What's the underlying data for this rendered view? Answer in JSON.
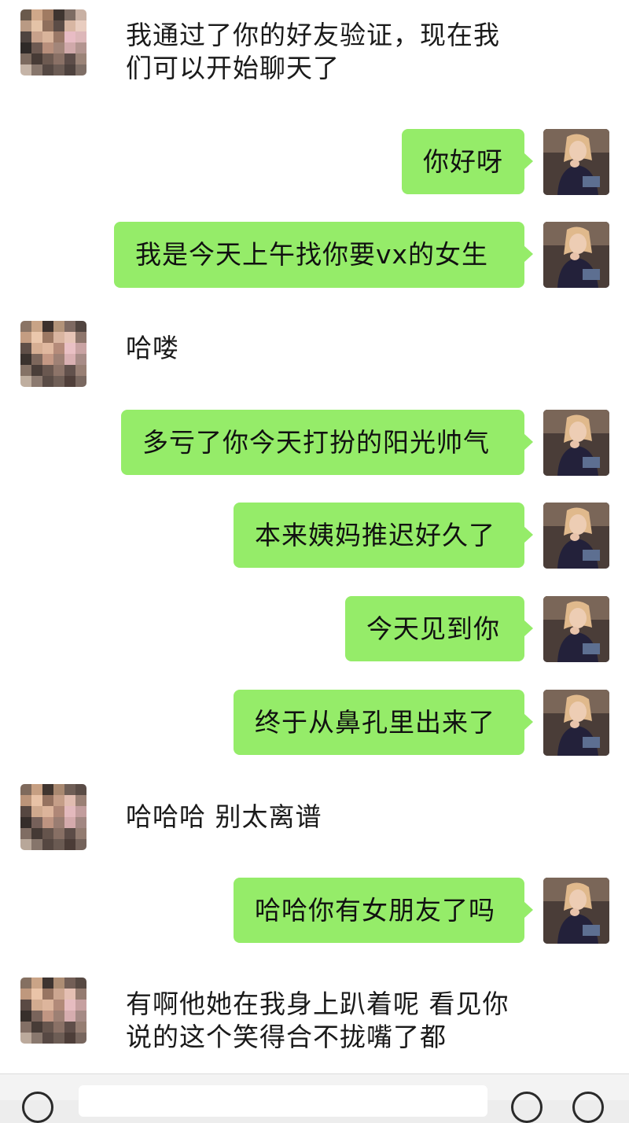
{
  "colors": {
    "chat_bg": "#ffffff",
    "outgoing_bubble": "#95ec69",
    "incoming_text": "#1a1a1a",
    "bottom_bar": "#f3f3f3"
  },
  "messages": [
    {
      "side": "in",
      "lines": [
        "我通过了你的好友验证，现在我",
        "们可以开始聊天了"
      ]
    },
    {
      "side": "out",
      "text": "你好呀"
    },
    {
      "side": "out",
      "text": "我是今天上午找你要vx的女生"
    },
    {
      "side": "in",
      "lines": [
        "哈喽"
      ]
    },
    {
      "side": "out",
      "text": "多亏了你今天打扮的阳光帅气"
    },
    {
      "side": "out",
      "text": "本来姨妈推迟好久了"
    },
    {
      "side": "out",
      "text": "今天见到你"
    },
    {
      "side": "out",
      "text": "终于从鼻孔里出来了"
    },
    {
      "side": "in",
      "lines": [
        "哈哈哈 别太离谱"
      ]
    },
    {
      "side": "out",
      "text": "哈哈你有女朋友了吗"
    },
    {
      "side": "in",
      "lines": [
        "有啊他她在我身上趴着呢 看见你",
        "说的这个笑得合不拢嘴了都"
      ]
    }
  ],
  "avatars": {
    "contact": "mosaic-pixelated-avatar",
    "self": "girl-photo-avatar"
  },
  "bottom_bar": {
    "voice_icon": "voice-circle-icon",
    "emoji_icon": "emoji-circle-icon",
    "more_icon": "plus-circle-icon"
  }
}
